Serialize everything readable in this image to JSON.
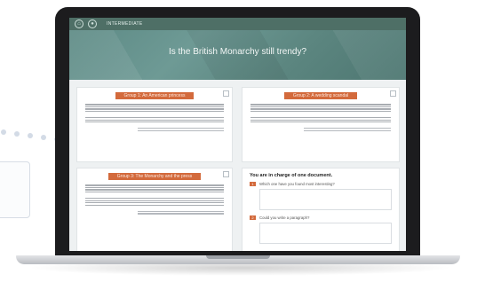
{
  "app": {
    "brand": "INTERMEDIATE"
  },
  "hero": {
    "title": "Is the British Monarchy still trendy?"
  },
  "cards": [
    {
      "label": "Group 1: An American princess"
    },
    {
      "label": "Group 2: A wedding scandal"
    },
    {
      "label": "Group 3: The Monarchy and the press"
    }
  ],
  "activity": {
    "title": "You are in charge of one document.",
    "questions": [
      {
        "number": "1",
        "text": "Which one have you found most interesting?"
      },
      {
        "number": "2",
        "text": "Could you write a paragraph?"
      }
    ]
  },
  "colors": {
    "accent": "#d36a3c",
    "header": "#4e6f66",
    "hero": "#6e9a95"
  }
}
